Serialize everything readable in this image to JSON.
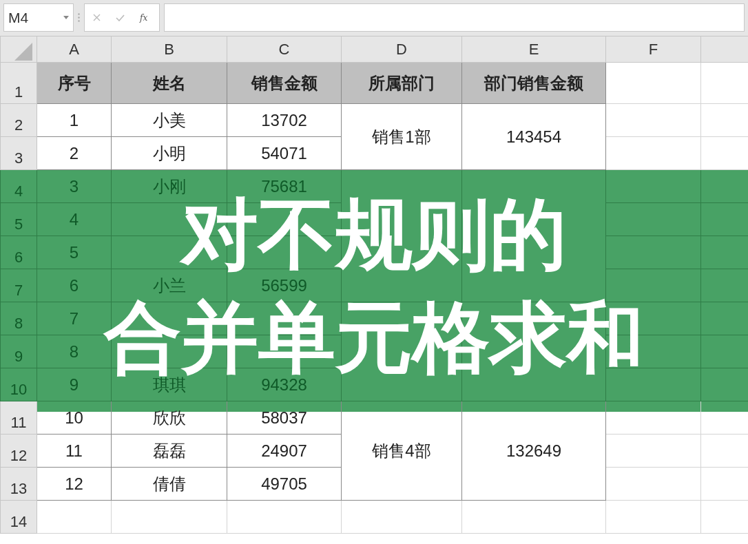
{
  "name_box": {
    "value": "M4"
  },
  "formula_bar": {
    "function_label": "fx"
  },
  "columns": [
    "A",
    "B",
    "C",
    "D",
    "E",
    "F"
  ],
  "header": {
    "label": "1",
    "cells": [
      "序号",
      "姓名",
      "销售金额",
      "所属部门",
      "部门销售金额"
    ]
  },
  "departments": [
    {
      "name": "销售1部",
      "total": "143454",
      "rows": [
        {
          "label": "2",
          "no": "1",
          "name": "小美",
          "amount": "13702"
        },
        {
          "label": "3",
          "no": "2",
          "name": "小明",
          "amount": "54071"
        }
      ]
    },
    {
      "rows": [
        {
          "label": "4",
          "no": "3",
          "name": "小刚",
          "amount": "75681",
          "under_banner": true
        },
        {
          "label": "5",
          "no": "4",
          "under_banner": true
        },
        {
          "label": "6",
          "no": "5",
          "under_banner": true
        },
        {
          "label": "7",
          "no": "6",
          "name": "小兰",
          "amount": "56599",
          "under_banner": true
        }
      ]
    },
    {
      "rows": [
        {
          "label": "8",
          "no": "7",
          "under_banner": true
        },
        {
          "label": "9",
          "no": "8",
          "under_banner": true
        },
        {
          "label": "10",
          "no": "9",
          "name": "琪琪",
          "amount": "94328",
          "under_banner": true
        }
      ]
    },
    {
      "name": "销售4部",
      "total": "132649",
      "rows": [
        {
          "label": "11",
          "no": "10",
          "name": "欣欣",
          "amount": "58037"
        },
        {
          "label": "12",
          "no": "11",
          "name": "磊磊",
          "amount": "24907"
        },
        {
          "label": "13",
          "no": "12",
          "name": "倩倩",
          "amount": "49705"
        }
      ]
    }
  ],
  "empty_rows": [
    "14"
  ],
  "banner": {
    "lines": [
      "对不规则的",
      "合并单元格求和"
    ]
  }
}
